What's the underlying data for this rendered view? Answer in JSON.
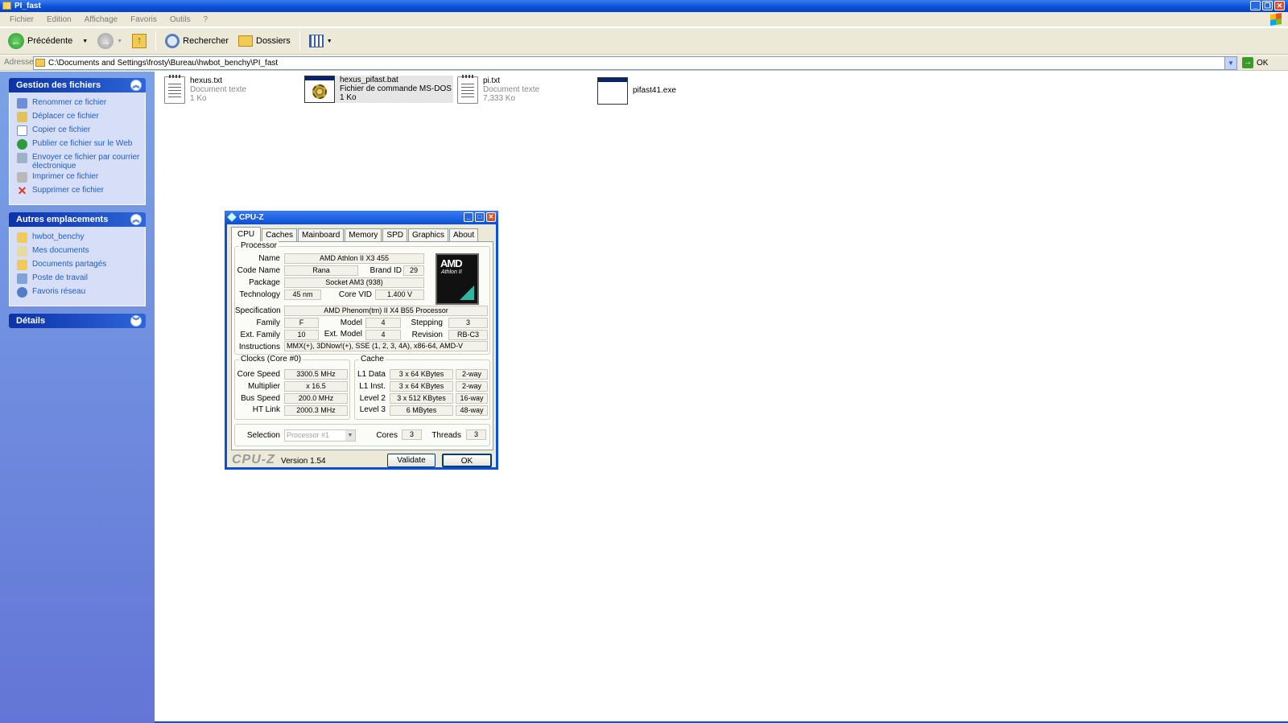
{
  "window": {
    "title": "PI_fast"
  },
  "menu": [
    "Fichier",
    "Edition",
    "Affichage",
    "Favoris",
    "Outils",
    "?"
  ],
  "toolbar": {
    "back": "Précédente",
    "search": "Rechercher",
    "folders": "Dossiers"
  },
  "address": {
    "label": "Adresse",
    "path": "C:\\Documents and Settings\\frosty\\Bureau\\hwbot_benchy\\PI_fast",
    "go": "OK"
  },
  "tasks": {
    "title": "Gestion des fichiers",
    "items": [
      "Renommer ce fichier",
      "Déplacer ce fichier",
      "Copier ce fichier",
      "Publier ce fichier sur le Web",
      "Envoyer ce fichier par courrier électronique",
      "Imprimer ce fichier",
      "Supprimer ce fichier"
    ]
  },
  "places": {
    "title": "Autres emplacements",
    "items": [
      "hwbot_benchy",
      "Mes documents",
      "Documents partagés",
      "Poste de travail",
      "Favoris réseau"
    ]
  },
  "details": {
    "title": "Détails"
  },
  "files": [
    {
      "name": "hexus.txt",
      "type": "Document texte",
      "size": "1 Ko"
    },
    {
      "name": "hexus_pifast.bat",
      "type": "Fichier de commande MS-DOS",
      "size": "1 Ko"
    },
    {
      "name": "pi.txt",
      "type": "Document texte",
      "size": "7,333 Ko"
    },
    {
      "name": "pifast41.exe",
      "type": "",
      "size": ""
    }
  ],
  "cpuz": {
    "title": "CPU-Z",
    "tabs": [
      "CPU",
      "Caches",
      "Mainboard",
      "Memory",
      "SPD",
      "Graphics",
      "About"
    ],
    "processor": {
      "group": "Processor",
      "name_l": "Name",
      "name": "AMD Athlon II X3 455",
      "code_l": "Code Name",
      "code": "Rana",
      "brand_l": "Brand ID",
      "brand": "29",
      "pkg_l": "Package",
      "pkg": "Socket AM3 (938)",
      "tech_l": "Technology",
      "tech": "45 nm",
      "vid_l": "Core VID",
      "vid": "1.400 V",
      "spec_l": "Specification",
      "spec": "AMD Phenom(tm) II X4 B55 Processor",
      "fam_l": "Family",
      "fam": "F",
      "model_l": "Model",
      "model": "4",
      "step_l": "Stepping",
      "step": "3",
      "efam_l": "Ext. Family",
      "efam": "10",
      "emodel_l": "Ext. Model",
      "emodel": "4",
      "rev_l": "Revision",
      "rev": "RB-C3",
      "instr_l": "Instructions",
      "instr": "MMX(+), 3DNow!(+), SSE (1, 2, 3, 4A), x86-64, AMD-V",
      "logo1": "AMD",
      "logo2": "Athlon II"
    },
    "clocks": {
      "group": "Clocks (Core #0)",
      "cs_l": "Core Speed",
      "cs": "3300.5 MHz",
      "mul_l": "Multiplier",
      "mul": "x 16.5",
      "bus_l": "Bus Speed",
      "bus": "200.0 MHz",
      "ht_l": "HT Link",
      "ht": "2000.3 MHz"
    },
    "cache": {
      "group": "Cache",
      "l1d_l": "L1 Data",
      "l1d": "3 x 64 KBytes",
      "l1d_w": "2-way",
      "l1i_l": "L1 Inst.",
      "l1i": "3 x 64 KBytes",
      "l1i_w": "2-way",
      "l2_l": "Level 2",
      "l2": "3 x 512 KBytes",
      "l2_w": "16-way",
      "l3_l": "Level 3",
      "l3": "6 MBytes",
      "l3_w": "48-way"
    },
    "sel": {
      "label": "Selection",
      "value": "Processor #1",
      "cores_l": "Cores",
      "cores": "3",
      "threads_l": "Threads",
      "threads": "3"
    },
    "footer": {
      "brand": "CPU-Z",
      "version": "Version 1.54",
      "validate": "Validate",
      "ok": "OK"
    }
  }
}
